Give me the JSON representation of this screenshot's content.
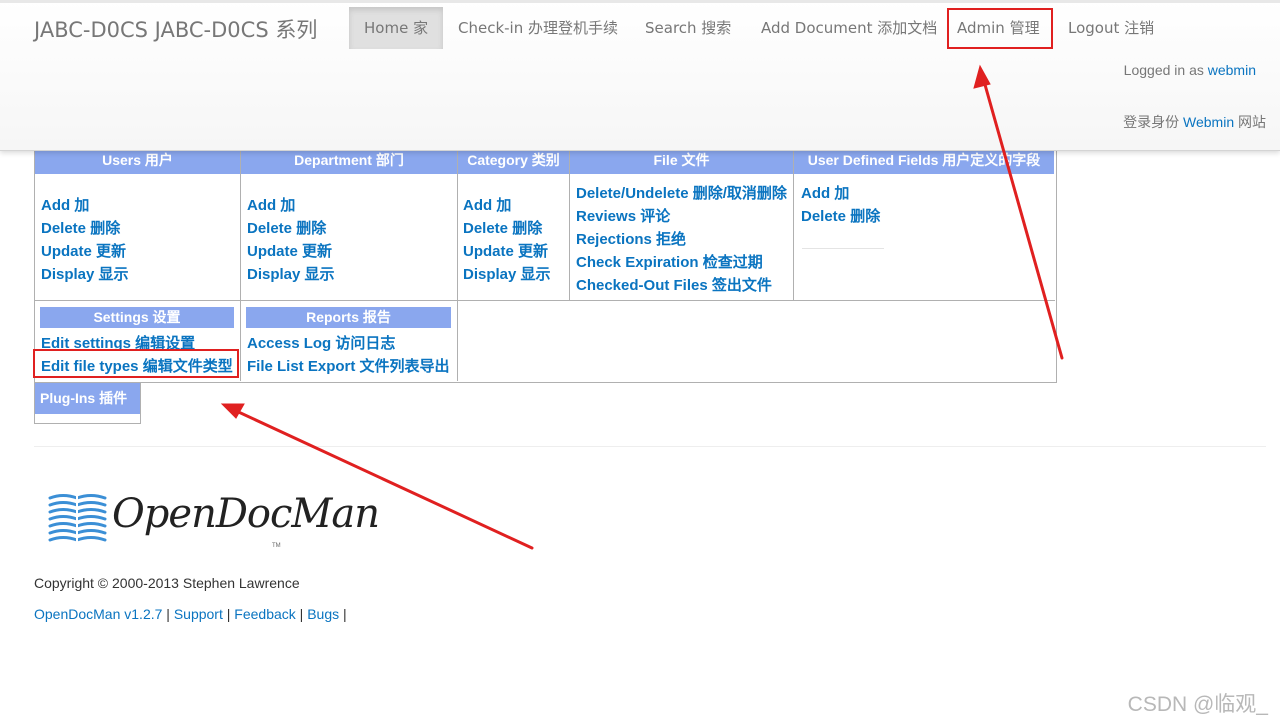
{
  "navbar": {
    "brand": "JABC-D0CS  JABC-D0CS 系列",
    "items": [
      {
        "label": "Home 家"
      },
      {
        "label": "Check-in  办理登机手续"
      },
      {
        "label": "Search  搜索"
      },
      {
        "label": "Add Document  添加文档"
      },
      {
        "label": "Admin  管理"
      },
      {
        "label": "Logout  注销"
      }
    ],
    "logged_in_prefix": "Logged in as",
    "logged_in_user": "webmin",
    "logged_in_cn_prefix": "登录身份",
    "logged_in_cn_user": "Webmin",
    "logged_in_cn_suffix": "网站"
  },
  "admin": {
    "headers": [
      "Users  用户",
      "Department  部门",
      "Category  类别",
      "File  文件",
      "User Defined Fields  用户定义的字段"
    ],
    "users_links": [
      "Add  加",
      "Delete  删除",
      "Update  更新",
      "Display  显示"
    ],
    "department_links": [
      "Add  加",
      "Delete  删除",
      "Update  更新",
      "Display  显示"
    ],
    "category_links": [
      "Add  加",
      "Delete  删除",
      "Update  更新",
      "Display  显示"
    ],
    "file_links": [
      "Delete/Undelete  删除/取消删除",
      "Reviews  评论",
      "Rejections  拒绝",
      "Check Expiration  检查过期",
      "Checked-Out Files  签出文件"
    ],
    "udf_links": [
      "Add  加",
      "Delete  删除"
    ],
    "settings": {
      "title": "Settings  设置",
      "links": [
        "Edit settings  编辑设置",
        "Edit file types  编辑文件类型"
      ]
    },
    "reports": {
      "title": "Reports  报告",
      "links": [
        "Access Log  访问日志",
        "File List Export  文件列表导出"
      ]
    },
    "plugins_title": "Plug-Ins  插件"
  },
  "footer": {
    "logo_text": "OpenDocMan",
    "logo_tm": "TM",
    "copyright": "Copyright © 2000-2013 Stephen Lawrence",
    "version_link": "OpenDocMan v1.2.7",
    "support_link": "Support",
    "feedback_link": "Feedback",
    "bugs_link": "Bugs",
    "separator": "|"
  },
  "watermark": "CSDN @临观_",
  "colors": {
    "header_blue": "#8aa7ee",
    "link_blue": "#0a74c0",
    "annotation_red": "#e02020"
  }
}
